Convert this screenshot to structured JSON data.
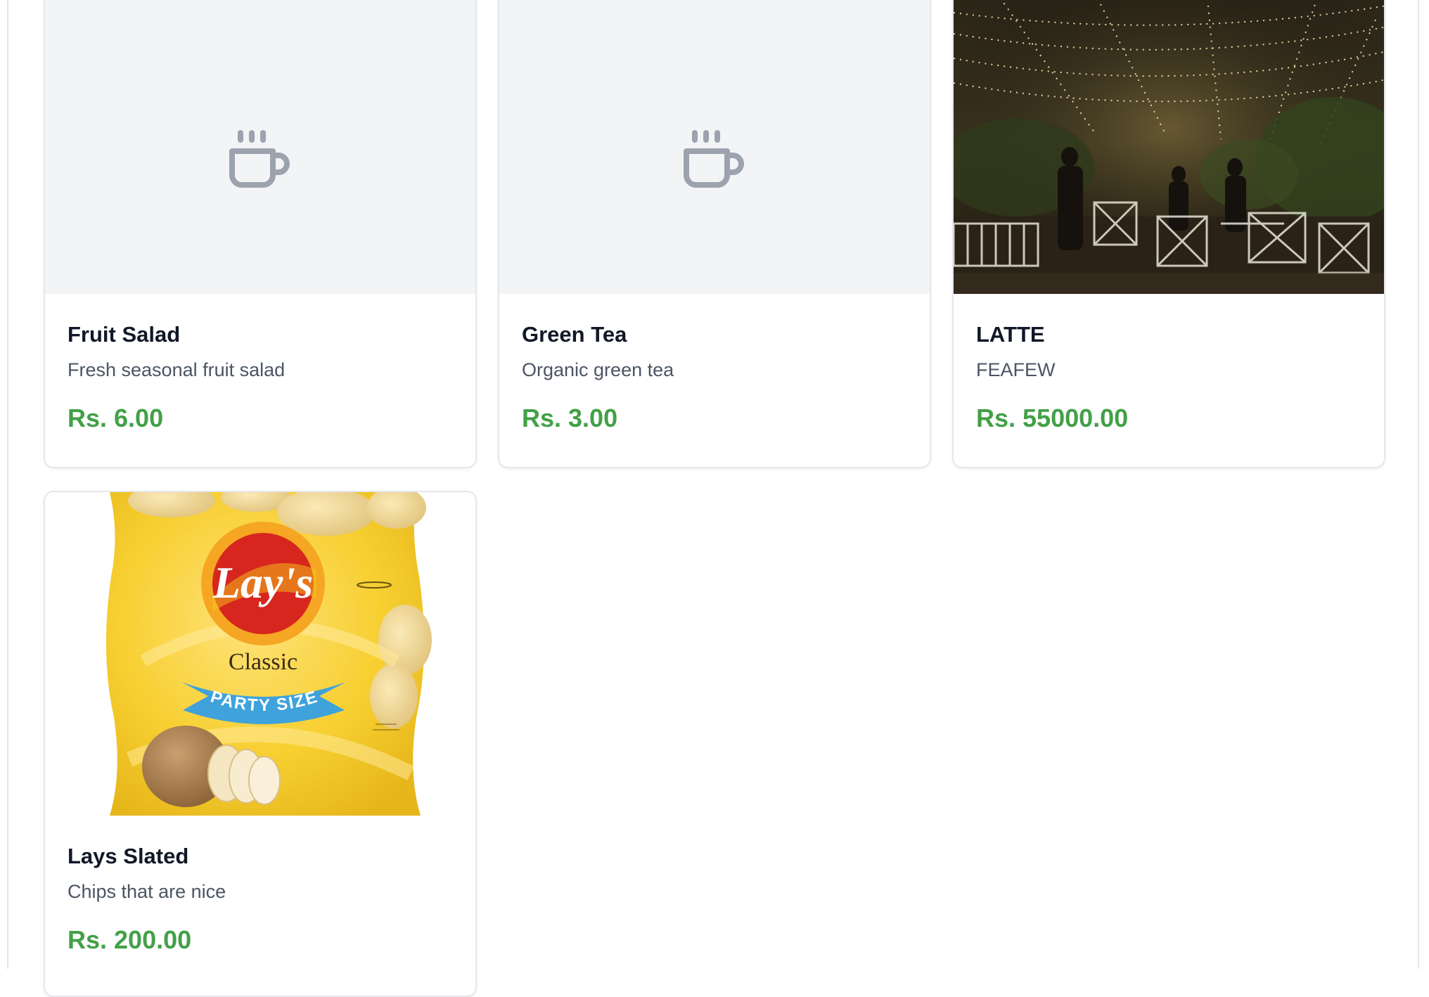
{
  "colors": {
    "price": "#43a047",
    "title": "#111827",
    "description": "#4b5563",
    "placeholder_bg": "#f3f4f6",
    "placeholder_icon": "#9ca3af",
    "card_border": "#e5e7eb"
  },
  "products": [
    {
      "name": "Fruit Salad",
      "description": "Fresh seasonal fruit salad",
      "price": "Rs. 6.00",
      "image": "coffee-cup-placeholder-icon"
    },
    {
      "name": "Green Tea",
      "description": "Organic green tea",
      "price": "Rs. 3.00",
      "image": "coffee-cup-placeholder-icon"
    },
    {
      "name": "LATTE",
      "description": "FEAFEW",
      "price": "Rs. 55000.00",
      "image": "restaurant-night-photo"
    },
    {
      "name": "Lays Slated",
      "description": "Chips that are nice",
      "price": "Rs. 200.00",
      "image": "lays-chips-bag-photo",
      "image_text": {
        "brand": "Lay's",
        "flavor": "Classic",
        "banner": "PARTY SIZE"
      }
    }
  ]
}
